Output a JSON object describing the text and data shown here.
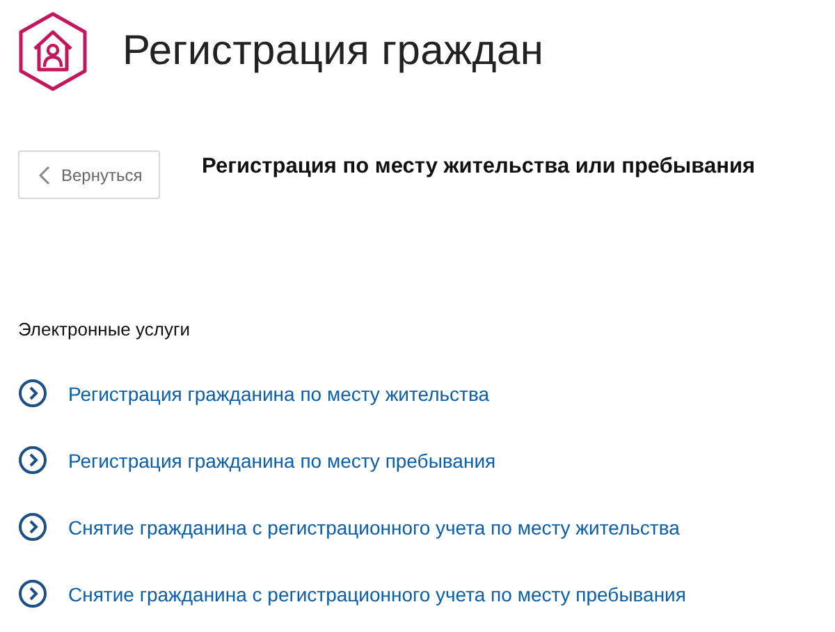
{
  "header": {
    "title": "Регистрация граждан"
  },
  "back_button": {
    "label": "Вернуться"
  },
  "page_title": "Регистрация по месту жительства или пребывания",
  "section": {
    "title": "Электронные услуги",
    "links": [
      {
        "label": "Регистрация гражданина по месту жительства"
      },
      {
        "label": "Регистрация гражданина по месту пребывания"
      },
      {
        "label": "Снятие гражданина с регистрационного учета по месту жительства"
      },
      {
        "label": "Снятие гражданина с регистрационного учета по месту пребывания"
      }
    ]
  }
}
